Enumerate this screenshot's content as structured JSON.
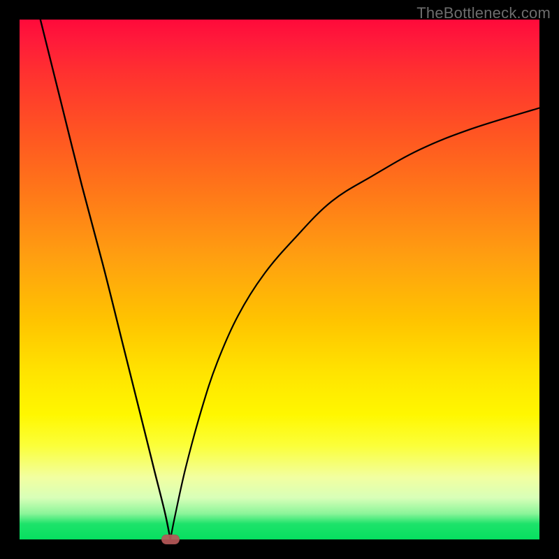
{
  "watermark": "TheBottleneck.com",
  "colors": {
    "frame": "#000000",
    "curve": "#000000",
    "marker": "#b85a5a"
  },
  "chart_data": {
    "type": "line",
    "title": "",
    "xlabel": "",
    "ylabel": "",
    "xlim": [
      0,
      100
    ],
    "ylim": [
      0,
      100
    ],
    "grid": false,
    "legend": false,
    "note": "V-shaped bottleneck curve over red→green gradient. Values estimated from pixel positions (no axis ticks shown).",
    "minimum": {
      "x": 29,
      "y": 0
    },
    "series": [
      {
        "name": "left-branch",
        "x": [
          4,
          8,
          12,
          16,
          20,
          24,
          26,
          28,
          29
        ],
        "y": [
          100,
          84,
          68,
          53,
          37,
          21,
          13,
          5,
          0
        ]
      },
      {
        "name": "right-branch",
        "x": [
          29,
          30,
          32,
          35,
          38,
          42,
          47,
          53,
          60,
          68,
          77,
          87,
          100
        ],
        "y": [
          0,
          5,
          14,
          25,
          34,
          43,
          51,
          58,
          65,
          70,
          75,
          79,
          83
        ]
      }
    ]
  }
}
